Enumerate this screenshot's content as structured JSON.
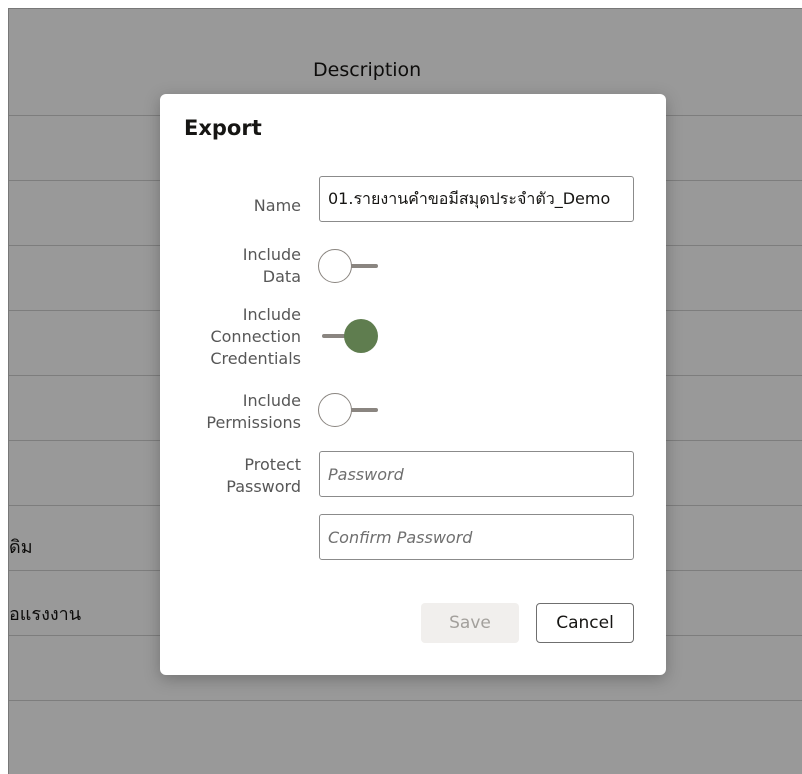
{
  "background": {
    "column_header": "Description",
    "row_texts": [
      "",
      "",
      "",
      "",
      "",
      "",
      "ดิม",
      "อแรงงาน",
      "",
      ""
    ]
  },
  "dialog": {
    "title": "Export",
    "name_label": "Name",
    "name_value": "01.รายงานคำขอมีสมุดประจำตัว_Demo",
    "include_data_label": "Include\nData",
    "include_data_on": false,
    "include_credentials_label": "Include\nConnection\nCredentials",
    "include_credentials_on": true,
    "include_permissions_label": "Include\nPermissions",
    "include_permissions_on": false,
    "protect_password_label": "Protect\nPassword",
    "password_placeholder": "Password",
    "confirm_password_placeholder": "Confirm Password",
    "save_label": "Save",
    "cancel_label": "Cancel",
    "accent_color": "#5f7d4f"
  }
}
